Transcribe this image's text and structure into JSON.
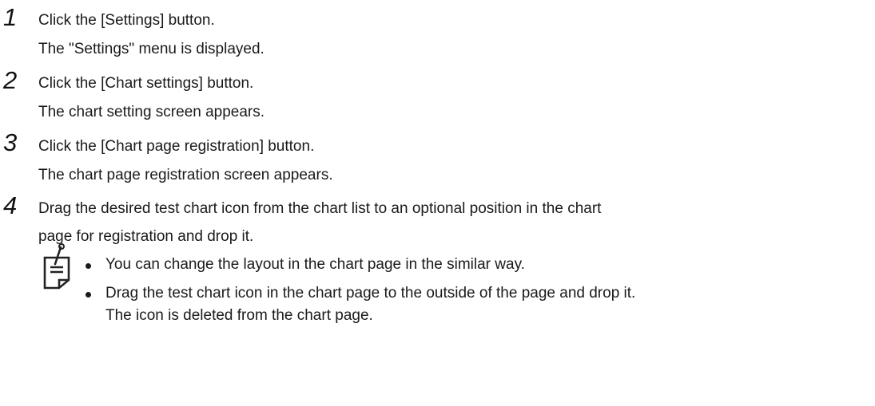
{
  "steps": [
    {
      "number": "1",
      "instruction": "Click the [Settings] button.",
      "result": "The \"Settings\" menu is displayed."
    },
    {
      "number": "2",
      "instruction": "Click the [Chart settings] button.",
      "result": "The chart setting screen appears."
    },
    {
      "number": "3",
      "instruction": "Click the [Chart page registration] button.",
      "result": "The chart page registration screen appears."
    },
    {
      "number": "4",
      "instruction_line1": "Drag the desired test chart icon from the chart list to an optional position in the chart",
      "instruction_line2": "page for registration and drop it."
    }
  ],
  "note": {
    "icon": "note-icon",
    "items": [
      {
        "text": "You can change the layout in the chart page in the similar way."
      },
      {
        "text_line1": "Drag the test chart icon in the chart page to the outside of the page and drop it.",
        "text_line2": "The icon is deleted from the chart page."
      }
    ]
  }
}
